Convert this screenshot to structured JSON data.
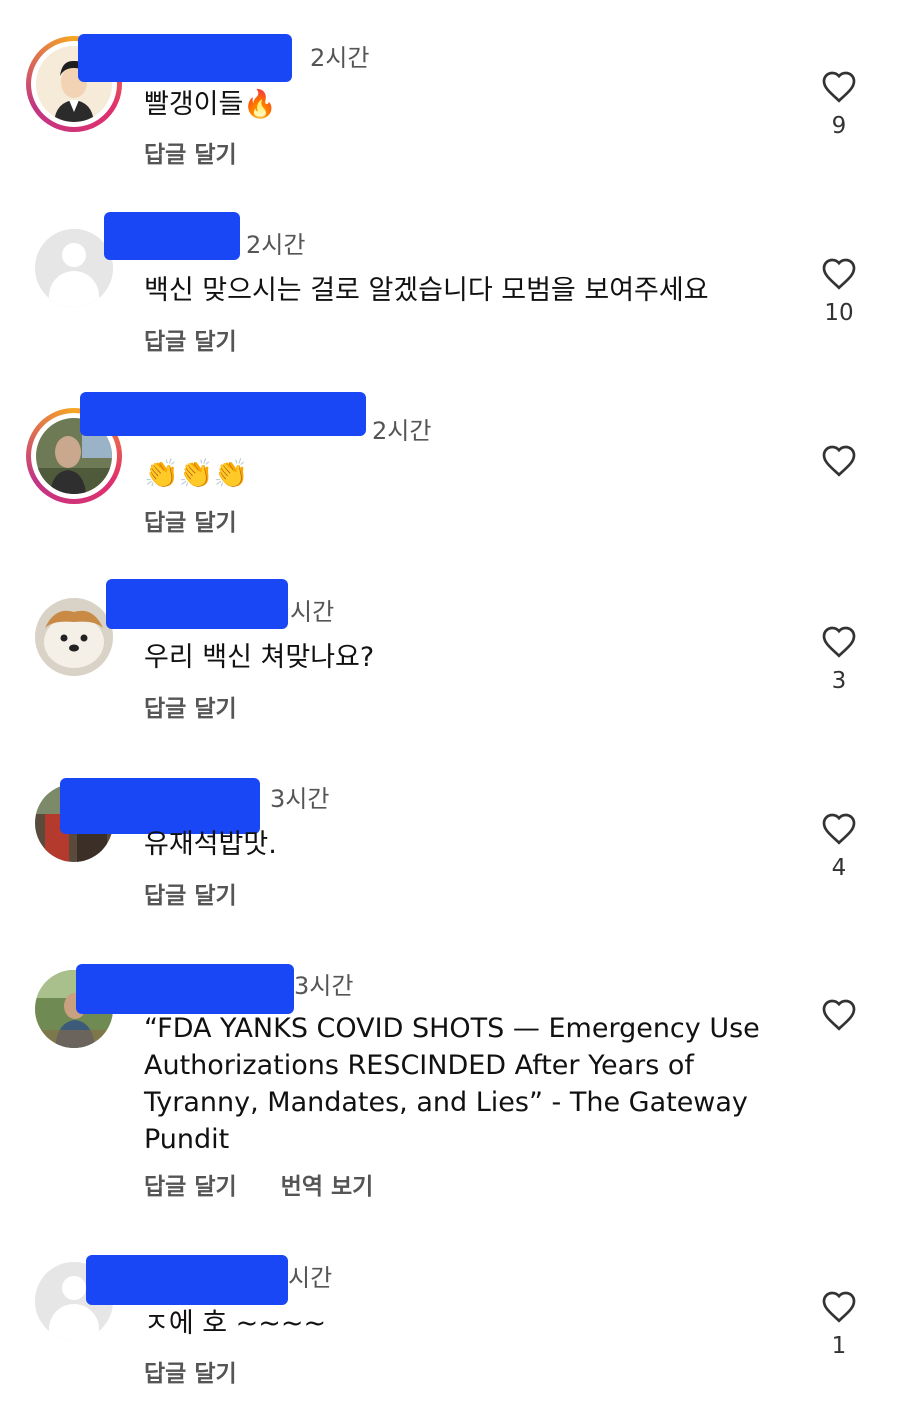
{
  "actions": {
    "reply": "답글 달기",
    "translate": "번역 보기"
  },
  "colors": {
    "redaction": "#1a47f5",
    "story_ring": "#e1306c"
  },
  "comments": [
    {
      "time": "2시간",
      "text": "빨갱이들🔥",
      "likes": "9"
    },
    {
      "time": "2시간",
      "text": "백신 맞으시는 걸로 알겠습니다 모범을 보여주세요",
      "likes": "10"
    },
    {
      "time": "2시간",
      "text": "👏👏👏",
      "likes": ""
    },
    {
      "time": "시간",
      "text": "우리 백신 쳐맞나요?",
      "likes": "3"
    },
    {
      "time": "3시간",
      "text": "유재석밥맛.",
      "likes": "4"
    },
    {
      "time": "3시간",
      "text": "“FDA YANKS COVID SHOTS — Emergency Use Authorizations RESCINDED After Years of Tyranny, Mandates, and Lies” - The Gateway Pundit",
      "likes": ""
    },
    {
      "time": "시간",
      "text": "ㅈ에 호 ~~~~",
      "likes": "1"
    }
  ]
}
